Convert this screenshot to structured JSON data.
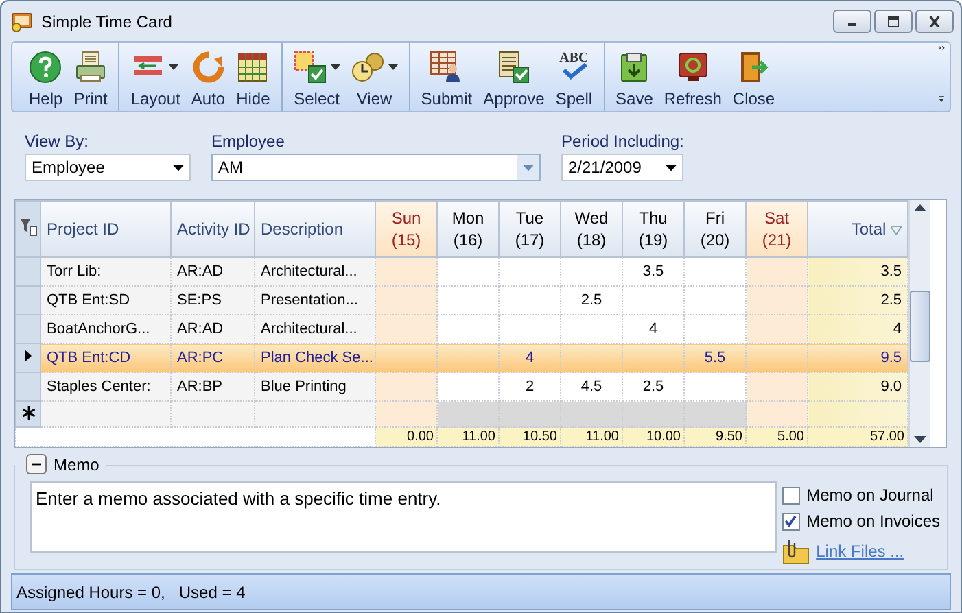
{
  "window": {
    "title": "Simple Time Card"
  },
  "toolbar": [
    {
      "label": "Help",
      "dropdown": false,
      "separator_before": false
    },
    {
      "label": "Print",
      "dropdown": false,
      "separator_before": false
    },
    {
      "label": "Layout",
      "dropdown": true,
      "separator_before": true
    },
    {
      "label": "Auto",
      "dropdown": false,
      "separator_before": false
    },
    {
      "label": "Hide",
      "dropdown": false,
      "separator_before": false
    },
    {
      "label": "Select",
      "dropdown": true,
      "separator_before": true
    },
    {
      "label": "View",
      "dropdown": true,
      "separator_before": false
    },
    {
      "label": "Submit",
      "dropdown": false,
      "separator_before": true
    },
    {
      "label": "Approve",
      "dropdown": false,
      "separator_before": false
    },
    {
      "label": "Spell",
      "dropdown": false,
      "separator_before": false,
      "icon_text": "ABC"
    },
    {
      "label": "Save",
      "dropdown": false,
      "separator_before": true
    },
    {
      "label": "Refresh",
      "dropdown": false,
      "separator_before": false
    },
    {
      "label": "Close",
      "dropdown": false,
      "separator_before": false
    }
  ],
  "filters": {
    "view_by": {
      "label": "View By:",
      "value": "Employee"
    },
    "employee": {
      "label": "Employee",
      "value": "AM"
    },
    "period": {
      "label": "Period Including:",
      "value": "2/21/2009"
    }
  },
  "grid": {
    "columns": [
      "Project ID",
      "Activity ID",
      "Description"
    ],
    "days": [
      {
        "name": "Sun",
        "date": "(15)",
        "weekend": true
      },
      {
        "name": "Mon",
        "date": "(16)",
        "weekend": false
      },
      {
        "name": "Tue",
        "date": "(17)",
        "weekend": false
      },
      {
        "name": "Wed",
        "date": "(18)",
        "weekend": false
      },
      {
        "name": "Thu",
        "date": "(19)",
        "weekend": false
      },
      {
        "name": "Fri",
        "date": "(20)",
        "weekend": false
      },
      {
        "name": "Sat",
        "date": "(21)",
        "weekend": true
      }
    ],
    "total_label": "Total",
    "rows": [
      {
        "project": "Torr Lib:",
        "activity": "AR:AD",
        "description": "Architectural...",
        "hours": {
          "4": "3.5"
        },
        "total": "3.5",
        "selected": false
      },
      {
        "project": "QTB Ent:SD",
        "activity": "SE:PS",
        "description": "Presentation...",
        "hours": {
          "3": "2.5"
        },
        "total": "2.5",
        "selected": false
      },
      {
        "project": "BoatAnchorG...",
        "activity": "AR:AD",
        "description": "Architectural...",
        "hours": {
          "4": "4"
        },
        "total": "4",
        "selected": false
      },
      {
        "project": "QTB Ent:CD",
        "activity": "AR:PC",
        "description": "Plan Check Se...",
        "hours": {
          "2": "4",
          "5": "5.5"
        },
        "total": "9.5",
        "selected": true
      },
      {
        "project": "Staples Center:",
        "activity": "AR:BP",
        "description": "Blue Printing",
        "hours": {
          "2": "2",
          "3": "4.5",
          "4": "2.5"
        },
        "total": "9.0",
        "selected": false
      }
    ],
    "totals": [
      "0.00",
      "11.00",
      "10.50",
      "11.00",
      "10.00",
      "9.50",
      "5.00"
    ],
    "grand_total": "57.00"
  },
  "memo": {
    "title": "Memo",
    "expanded": true,
    "text": "Enter a memo associated with a specific time entry.",
    "options": [
      {
        "label": "Memo on Journal",
        "checked": false
      },
      {
        "label": "Memo on Invoices",
        "checked": true
      }
    ],
    "link": "Link Files ..."
  },
  "status_bar": "Assigned Hours = 0,   Used = 4"
}
